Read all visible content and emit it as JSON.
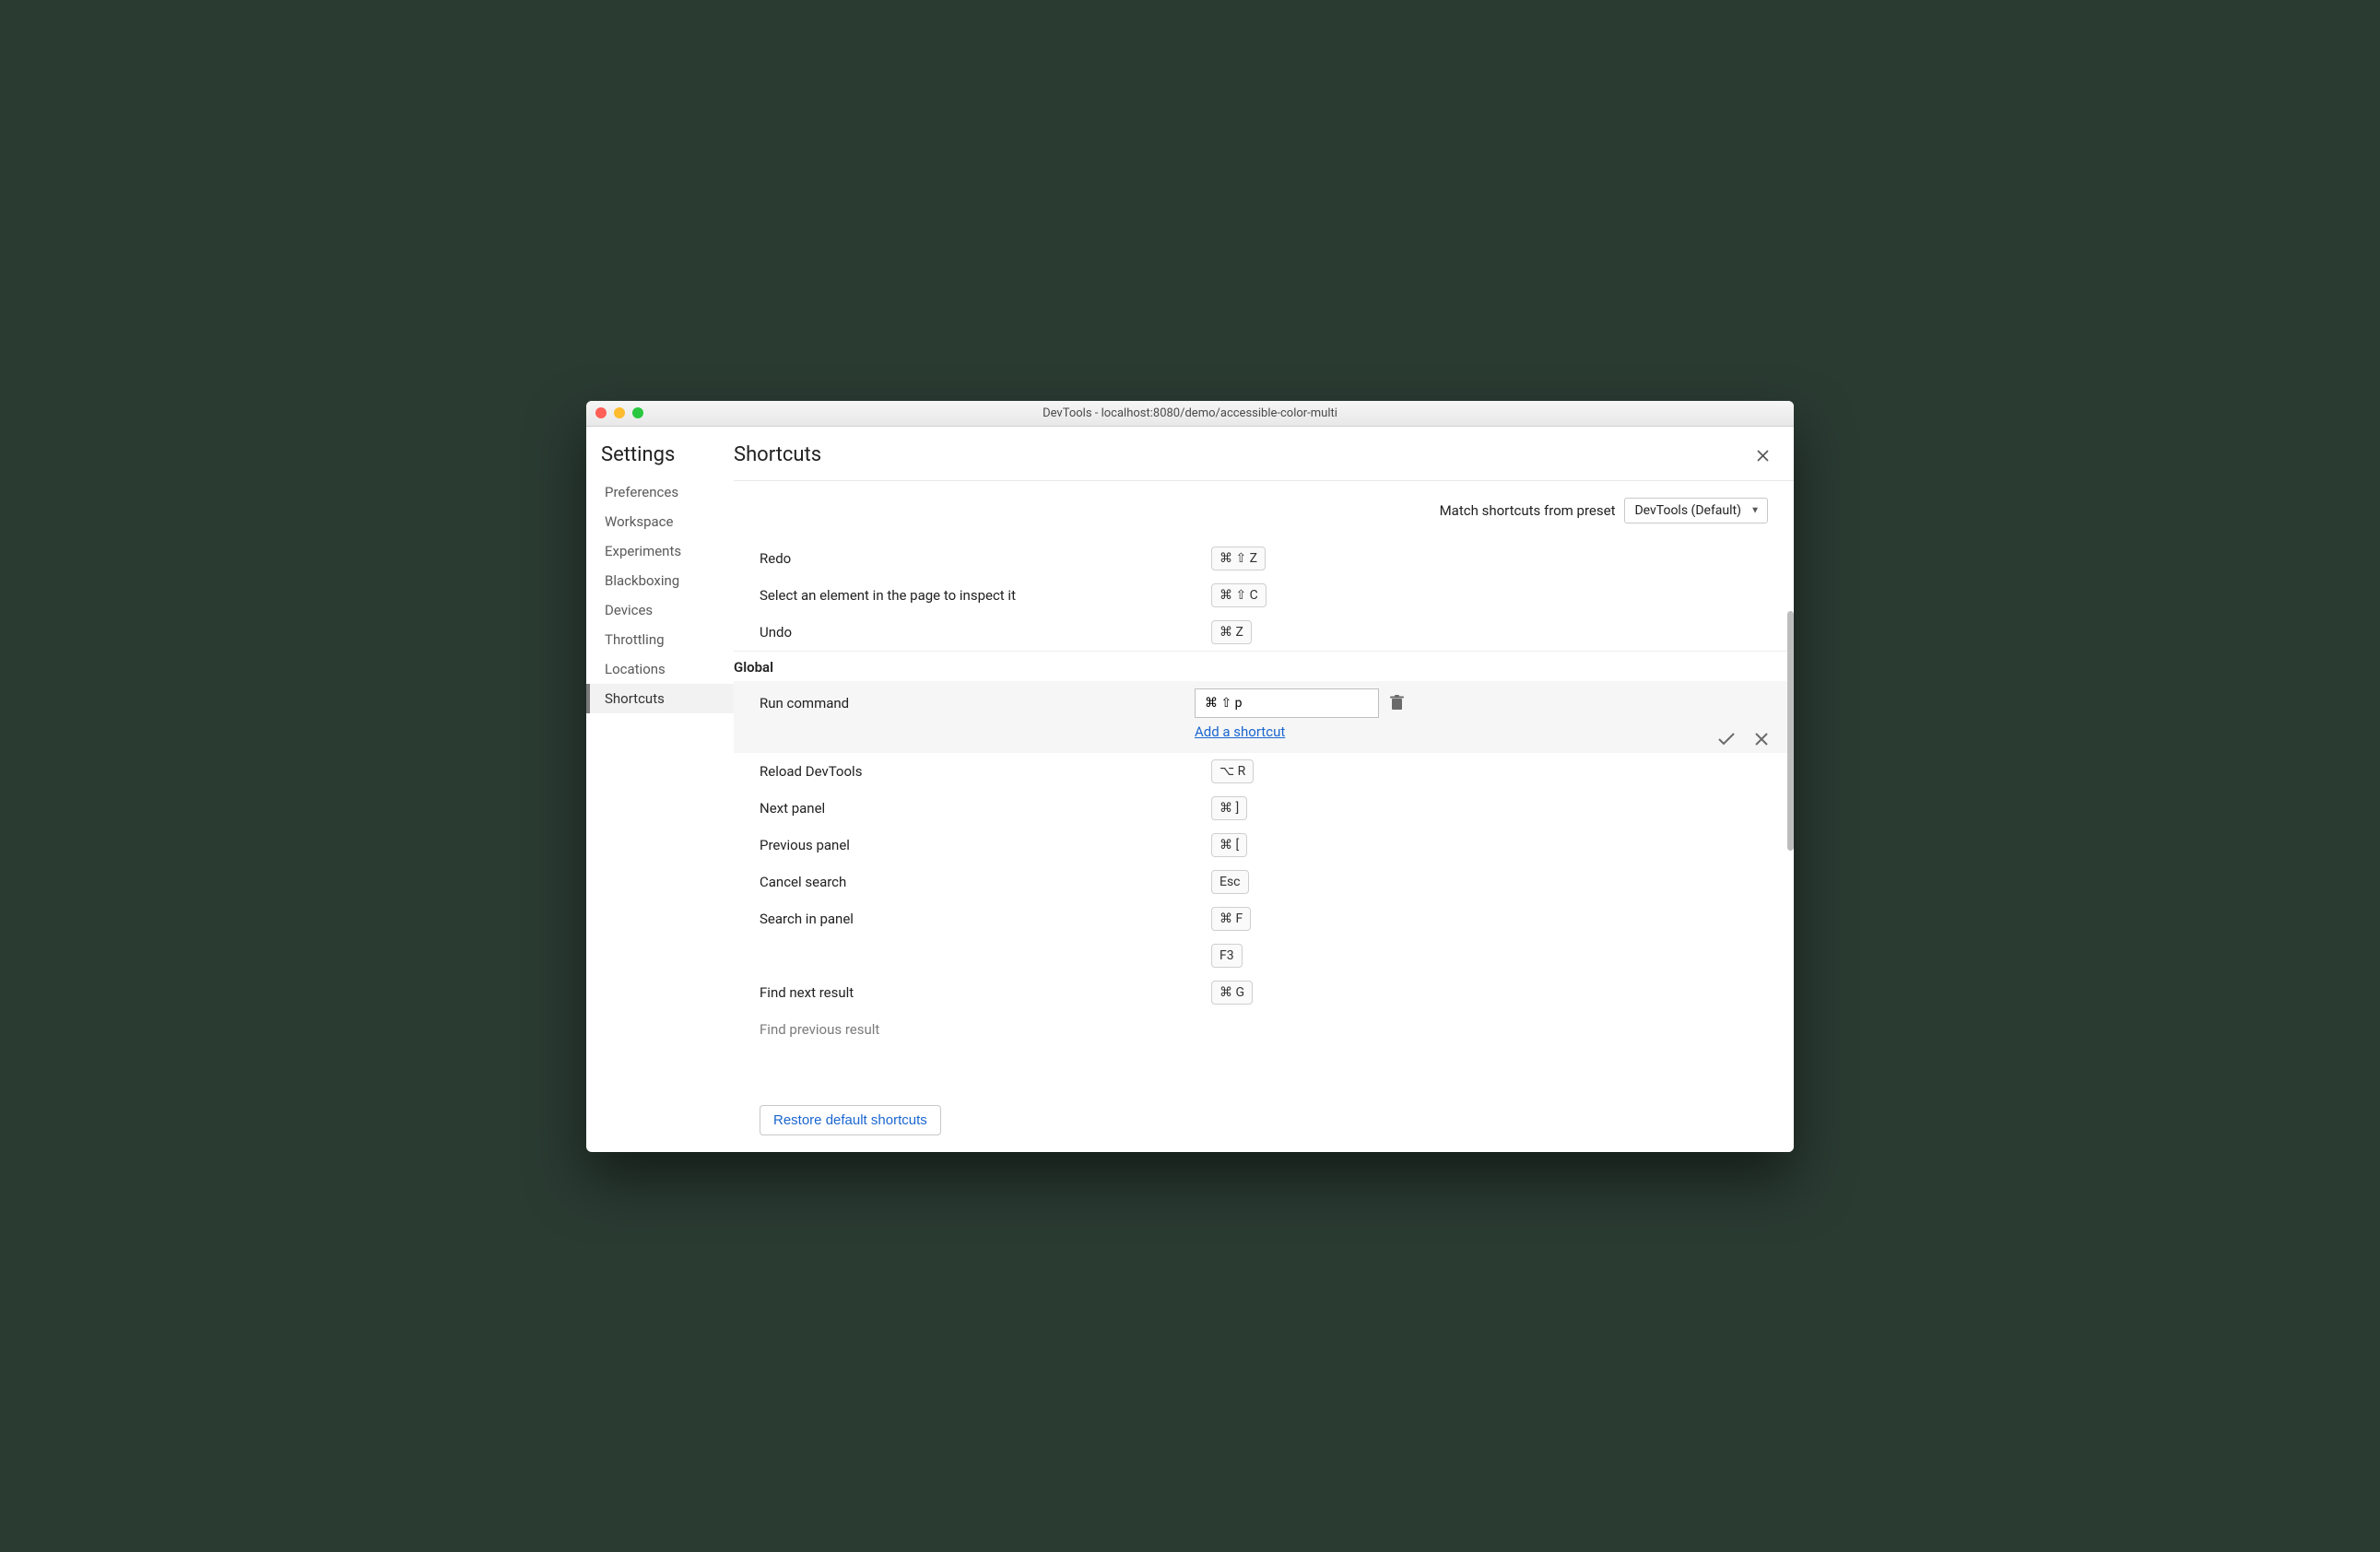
{
  "window": {
    "title": "DevTools - localhost:8080/demo/accessible-color-multi"
  },
  "sidebar": {
    "title": "Settings",
    "items": [
      {
        "label": "Preferences"
      },
      {
        "label": "Workspace"
      },
      {
        "label": "Experiments"
      },
      {
        "label": "Blackboxing"
      },
      {
        "label": "Devices"
      },
      {
        "label": "Throttling"
      },
      {
        "label": "Locations"
      },
      {
        "label": "Shortcuts"
      }
    ],
    "active_index": 7
  },
  "page": {
    "title": "Shortcuts"
  },
  "preset": {
    "label": "Match shortcuts from preset",
    "selected": "DevTools (Default)"
  },
  "top_rows": [
    {
      "label": "Redo",
      "keys": "⌘ ⇧ Z"
    },
    {
      "label": "Select an element in the page to inspect it",
      "keys": "⌘ ⇧ C"
    },
    {
      "label": "Undo",
      "keys": "⌘ Z"
    }
  ],
  "section": {
    "name": "Global"
  },
  "editing": {
    "label": "Run command",
    "input_value": "⌘ ⇧ p",
    "add_link": "Add a shortcut"
  },
  "global_rows": [
    {
      "label": "Reload DevTools",
      "keys": [
        "⌥ R"
      ]
    },
    {
      "label": "Next panel",
      "keys": [
        "⌘ ]"
      ]
    },
    {
      "label": "Previous panel",
      "keys": [
        "⌘ ["
      ]
    },
    {
      "label": "Cancel search",
      "keys": [
        "Esc"
      ]
    },
    {
      "label": "Search in panel",
      "keys": [
        "⌘ F",
        "F3"
      ]
    },
    {
      "label": "Find next result",
      "keys": [
        "⌘ G"
      ]
    },
    {
      "label": "Find previous result",
      "keys": []
    }
  ],
  "restore": {
    "label": "Restore default shortcuts"
  }
}
